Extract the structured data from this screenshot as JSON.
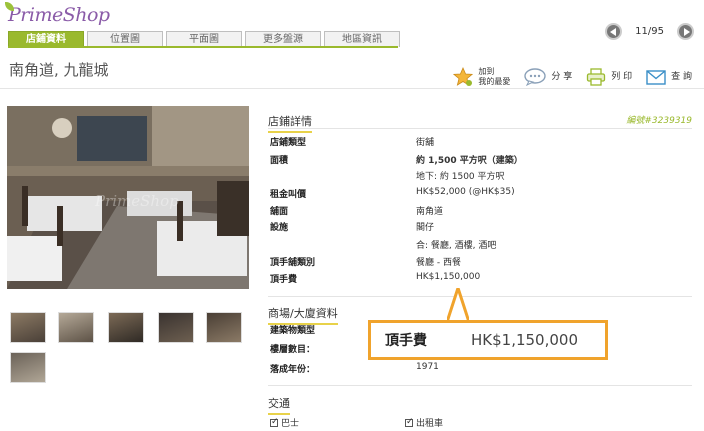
{
  "brand": {
    "logo_text": "PrimeShop",
    "accent": "#9ab92d",
    "callout_color": "#f0a32c"
  },
  "tabs": [
    {
      "label": "店鋪資料",
      "active": true
    },
    {
      "label": "位置圖"
    },
    {
      "label": "平面圖"
    },
    {
      "label": "更多盤源"
    },
    {
      "label": "地區資訊"
    }
  ],
  "pager": {
    "text": "11/95"
  },
  "address": "南角道, 九龍城",
  "actions": {
    "favorite": "加到\n我的最愛",
    "share": "分 享",
    "print": "列 印",
    "inquire": "查 詢"
  },
  "photo": {
    "watermark": "PrimeShop"
  },
  "details": {
    "title": "店鋪詳情",
    "ref": "編號#3239319",
    "rows": [
      {
        "k": "店鋪類型",
        "v": "街舖"
      },
      {
        "k": "面積",
        "v": "約 1,500 平方呎（建築）"
      },
      {
        "k": "",
        "v": "地下: 約 1500 平方呎"
      },
      {
        "k": "租金叫價",
        "v": "HK$52,000 (@HK$35)"
      },
      {
        "k": "舖面",
        "v": "南角道"
      },
      {
        "k": "設施",
        "v": "閣仔"
      },
      {
        "k": "",
        "v": "合: 餐廳, 酒樓, 酒吧"
      },
      {
        "k": "頂手舖類別",
        "v": "餐廳 - 西餐"
      },
      {
        "k": "頂手費",
        "v": "HK$1,150,000"
      }
    ]
  },
  "building": {
    "title": "商場/大廈資料",
    "rows": [
      {
        "k": "建築物類型",
        "v": ""
      },
      {
        "k": "樓層數目：",
        "v": ""
      },
      {
        "k": "落成年份：",
        "v": "1971"
      }
    ]
  },
  "callout": {
    "label": "頂手費",
    "value": "HK$1,150,000"
  },
  "transport": {
    "title": "交通",
    "items": [
      "巴士",
      "出租車"
    ]
  }
}
